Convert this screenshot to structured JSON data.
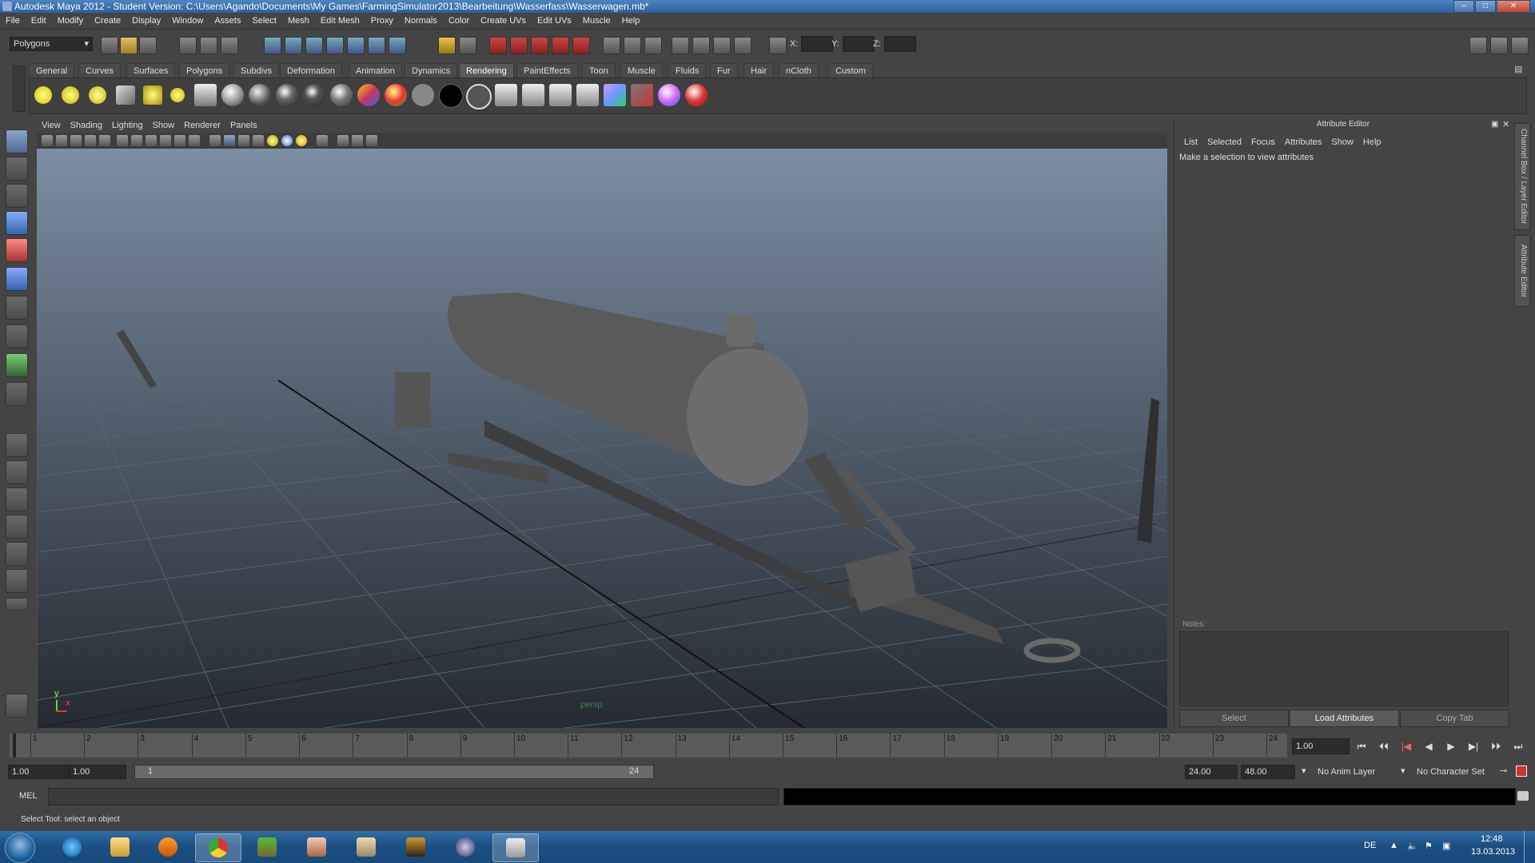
{
  "window": {
    "title": "Autodesk Maya 2012 - Student Version: C:\\Users\\Agando\\Documents\\My Games\\FarmingSimulator2013\\Bearbeitung\\Wasserfass\\Wasserwagen.mb*",
    "buttons": {
      "minimize": "–",
      "maximize": "□",
      "close": "✕"
    }
  },
  "menubar": [
    "File",
    "Edit",
    "Modify",
    "Create",
    "Display",
    "Window",
    "Assets",
    "Select",
    "Mesh",
    "Edit Mesh",
    "Proxy",
    "Normals",
    "Color",
    "Create UVs",
    "Edit UVs",
    "Muscle",
    "Help"
  ],
  "statusline": {
    "mode": "Polygons",
    "x_label": "X:",
    "y_label": "Y:",
    "z_label": "Z:"
  },
  "shelf": {
    "tabs": [
      "General",
      "Curves",
      "Surfaces",
      "Polygons",
      "Subdivs",
      "Deformation",
      "Animation",
      "Dynamics",
      "Rendering",
      "PaintEffects",
      "Toon",
      "Muscle",
      "Fluids",
      "Fur",
      "Hair",
      "nCloth",
      "Custom"
    ],
    "active_tab": "Rendering",
    "icons": [
      "ambient-light-icon",
      "directional-light-icon",
      "point-light-icon",
      "spot-light-icon",
      "area-light-icon",
      "volume-light-icon",
      "render-settings-icon",
      "sphere-render-icon",
      "lambert-icon",
      "blinn-icon",
      "phong-icon",
      "phonge-icon",
      "anisotropic-icon",
      "ramp-shader-icon",
      "layered-shader-icon",
      "surface-shader-icon",
      "black-shader-icon",
      "white-shader-icon",
      "hypershade-icon",
      "render-view-icon",
      "render-current-icon",
      "ipr-render-icon",
      "batch-render-icon",
      "render-layer-icon",
      "material-viewer-icon",
      "paint-tool-icon"
    ]
  },
  "viewport": {
    "menu": [
      "View",
      "Shading",
      "Lighting",
      "Show",
      "Renderer",
      "Panels"
    ],
    "camera_label": "persp",
    "axis_y": "y",
    "axis_x": "x"
  },
  "attribute_editor": {
    "header": "Attribute Editor",
    "menu": [
      "List",
      "Selected",
      "Focus",
      "Attributes",
      "Show",
      "Help"
    ],
    "message": "Make a selection to view attributes",
    "notes_label": "Notes:",
    "buttons": {
      "select": "Select",
      "load": "Load Attributes",
      "copy": "Copy Tab"
    }
  },
  "side_tabs": [
    "Channel Box / Layer Editor",
    "Attribute Editor"
  ],
  "timeslider": {
    "ticks": [
      "1",
      "2",
      "3",
      "4",
      "5",
      "6",
      "7",
      "8",
      "9",
      "10",
      "11",
      "12",
      "13",
      "14",
      "15",
      "16",
      "17",
      "18",
      "19",
      "20",
      "21",
      "22",
      "23",
      "24"
    ],
    "current_frame": "1.00",
    "playback": [
      "⏮",
      "⏴⏴",
      "|◀",
      "◀",
      "▶",
      "▶|",
      "⏵⏵",
      "⏭"
    ]
  },
  "range": {
    "start": "1.00",
    "playback_start": "1.00",
    "slider_start": "1",
    "slider_end": "24",
    "playback_end": "24.00",
    "end": "48.00",
    "anim_layer": "No Anim Layer",
    "character_set": "No Character Set"
  },
  "command_line": {
    "label": "MEL"
  },
  "helpline": {
    "text": "Select Tool: select an object"
  },
  "taskbar": {
    "apps": [
      "start-orb-icon",
      "internet-explorer-icon",
      "explorer-icon",
      "media-player-icon",
      "chrome-icon",
      "minecraft-icon",
      "game-icon-1",
      "game-icon-2",
      "game-icon-3",
      "unreal-icon",
      "maya-icon"
    ],
    "lang": "DE",
    "time": "12:48",
    "date": "13.03.2013"
  },
  "colors": {
    "accent": "#2d5f9c",
    "panel": "#444444",
    "viewport_top": "#7c8ea3",
    "viewport_bottom": "#262b31"
  }
}
